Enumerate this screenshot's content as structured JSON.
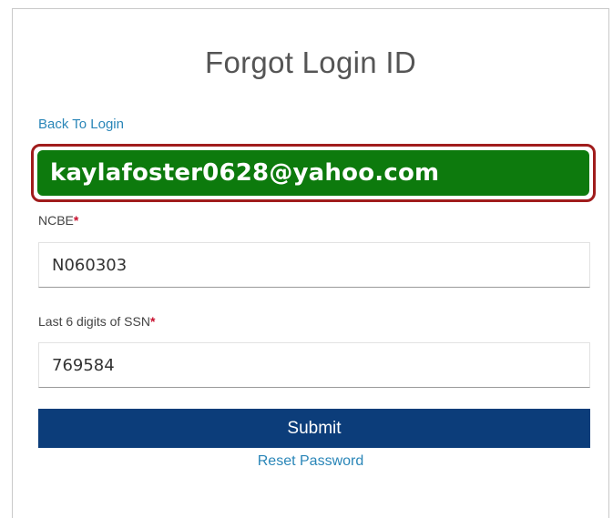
{
  "form": {
    "title": "Forgot Login ID",
    "back_link": "Back To Login",
    "email_overlay": "kaylafoster0628@yahoo.com",
    "ncbe_label": "NCBE",
    "ncbe_required": "*",
    "ncbe_value": "N060303",
    "ssn_label": "Last 6 digits of SSN",
    "ssn_required": "*",
    "ssn_value": "769584",
    "submit_label": "Submit",
    "reset_link": "Reset Password"
  },
  "colors": {
    "primary_button": "#0c3d7a",
    "link": "#2a86b8",
    "highlight_fill": "#0d7a0d",
    "highlight_border": "#a01c1c",
    "required": "#c8102e"
  }
}
